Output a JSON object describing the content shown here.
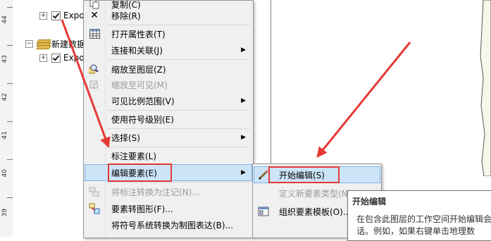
{
  "ruler": {
    "labels": [
      "44",
      "43",
      "42",
      "41",
      "40",
      "39"
    ]
  },
  "toc": {
    "layer1": "Expo",
    "group": "新建数据",
    "layer2": "Expo",
    "expand_collapsed": "+",
    "expand_expanded": "−"
  },
  "context_menu": {
    "items": [
      {
        "label": "复制(C)",
        "icon": "copy-icon",
        "enabled": true
      },
      {
        "label": "移除(R)",
        "icon": "remove-x-icon",
        "enabled": true
      },
      {
        "label": "打开属性表(T)",
        "icon": "table-icon",
        "enabled": true
      },
      {
        "label": "连接和关联(J)",
        "submenu": true,
        "enabled": true
      },
      {
        "label": "缩放至图层(Z)",
        "icon": "zoom-to-layer-icon",
        "enabled": true
      },
      {
        "label": "缩放至可见(M)",
        "icon": "zoom-to-visible-icon",
        "enabled": false
      },
      {
        "label": "可见比例范围(V)",
        "submenu": true,
        "enabled": true
      },
      {
        "label": "使用符号级别(E)",
        "enabled": true
      },
      {
        "label": "选择(S)",
        "submenu": true,
        "enabled": true
      },
      {
        "label": "标注要素(L)",
        "enabled": true
      },
      {
        "label": "编辑要素(E)",
        "submenu": true,
        "enabled": true,
        "highlighted": true
      },
      {
        "label": "将标注转换为注记(N)...",
        "icon": "convert-labels-icon",
        "enabled": false
      },
      {
        "label": "要素转图形(F)...",
        "icon": "features-to-graphics-icon",
        "enabled": true
      },
      {
        "label": "将符号系统转换为制图表达(B)...",
        "enabled": true
      }
    ]
  },
  "submenu": {
    "items": [
      {
        "label": "开始编辑(S)",
        "icon": "pencil-icon",
        "enabled": true
      },
      {
        "label": "定义新要素类型(N)...",
        "enabled": false
      },
      {
        "label": "组织要素模板(O)...",
        "icon": "templates-icon",
        "enabled": true
      }
    ]
  },
  "tooltip": {
    "title": "开始编辑",
    "body": "在包含此图层的工作空间开始编辑会话。例如，如果右键单击地理数"
  },
  "colors": {
    "annotation": "#e53935",
    "highlight": "#cce4f7",
    "highlight_border": "#7eb4ea"
  }
}
